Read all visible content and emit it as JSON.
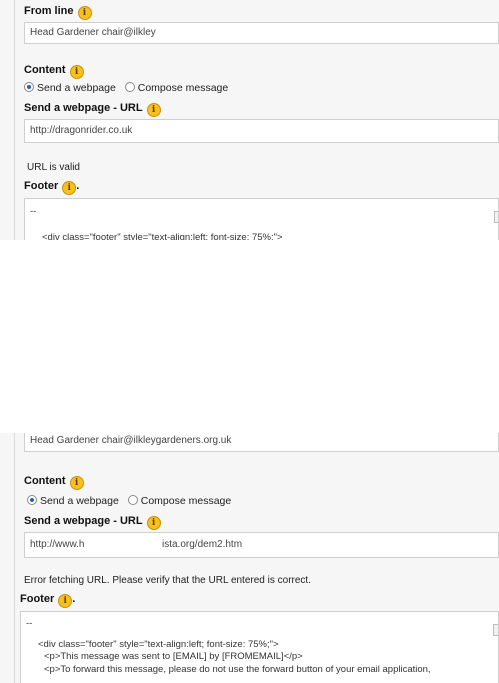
{
  "top": {
    "from_line": {
      "label": "From line",
      "value": "Head Gardener chair@ilkley"
    },
    "content": {
      "label": "Content",
      "options": [
        "Send a webpage",
        "Compose message"
      ],
      "selected": "Send a webpage"
    },
    "send_webpage": {
      "label": "Send a webpage - URL",
      "value": "http://dragonrider.co.uk"
    },
    "status_message": "URL is valid",
    "footer": {
      "label": "Footer",
      "lines": [
        "--",
        "<div class=\"footer\" style=\"text-align:left; font-size: 75%;\">"
      ]
    }
  },
  "bottom": {
    "from_line": {
      "value": "Head Gardener chair@ilkleygardeners.org.uk"
    },
    "content": {
      "label": "Content",
      "options": [
        "Send a webpage",
        "Compose message"
      ],
      "selected": "Send a webpage"
    },
    "send_webpage": {
      "label": "Send a webpage - URL",
      "value_left": "http://www.h",
      "value_right": "ista.org/dem2.htm"
    },
    "status_message": "Error fetching URL. Please verify that the URL entered is correct.",
    "footer": {
      "label": "Footer",
      "lines": [
        "--",
        "<div class=\"footer\" style=\"text-align:left; font-size: 75%;\">",
        "<p>This message was sent to [EMAIL] by [FROMEMAIL]</p>",
        "<p>To forward this message, please do not use the forward button of your email application,"
      ]
    }
  },
  "colors": {
    "panel_background": "#f6f6f6",
    "info_icon": "#f6c01e",
    "radio_selected": "#1e5fbf"
  },
  "icons": {
    "info": "info-icon",
    "radio_checked": "radio-checked-icon",
    "radio_unchecked": "radio-unchecked-icon"
  }
}
